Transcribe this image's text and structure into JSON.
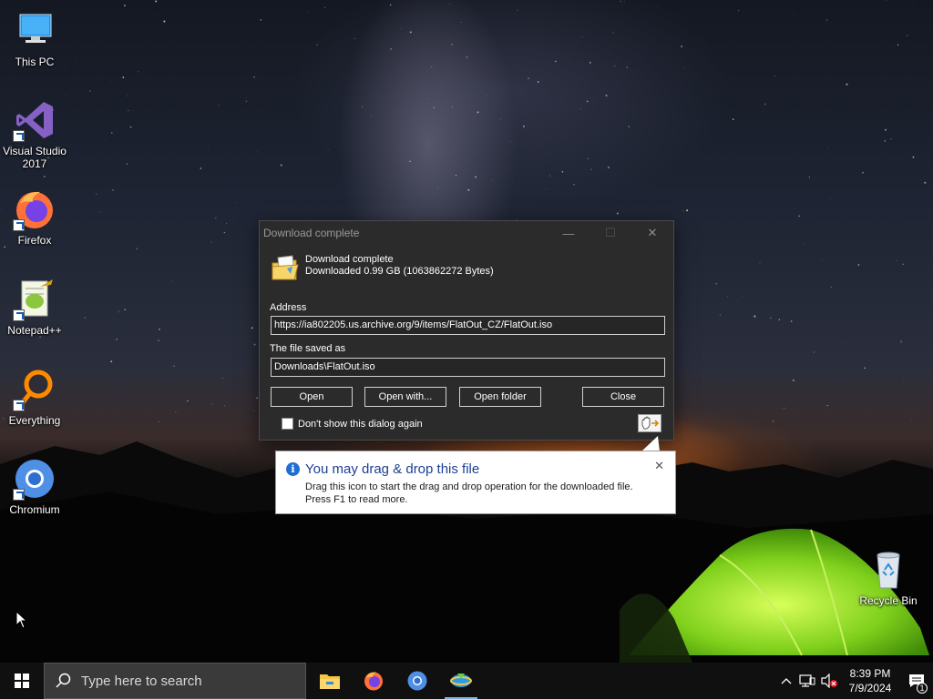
{
  "desktop": {
    "icons": [
      {
        "label": "This PC",
        "icon": "computer-icon"
      },
      {
        "label": "Visual Studio 2017",
        "icon": "visual-studio-icon"
      },
      {
        "label": "Firefox",
        "icon": "firefox-icon"
      },
      {
        "label": "Notepad++",
        "icon": "notepadpp-icon"
      },
      {
        "label": "Everything",
        "icon": "everything-search-icon"
      },
      {
        "label": "Chromium",
        "icon": "chromium-icon"
      },
      {
        "label": "Recycle Bin",
        "icon": "recycle-bin-icon"
      }
    ]
  },
  "dialog": {
    "title": "Download complete",
    "header_title": "Download complete",
    "header_detail": "Downloaded 0.99  GB (1063862272 Bytes)",
    "address_label": "Address",
    "address_value": "https://ia802205.us.archive.org/9/items/FlatOut_CZ/FlatOut.iso",
    "saved_label": "The file saved as",
    "saved_value": "Downloads\\FlatOut.iso",
    "buttons": {
      "open": "Open",
      "open_with": "Open with...",
      "open_folder": "Open folder",
      "close": "Close"
    },
    "checkbox_label": "Don't show this dialog again",
    "checkbox_checked": false
  },
  "tooltip": {
    "title": "You may drag & drop this file",
    "line1": "Drag this icon to start the drag and drop operation for the downloaded file.",
    "line2": "Press F1 to read more."
  },
  "taskbar": {
    "search_placeholder": "Type here to search",
    "apps": [
      "file-explorer-icon",
      "firefox-icon",
      "chromium-icon",
      "download-manager-icon"
    ],
    "time": "8:39 PM",
    "date": "7/9/2024",
    "notification_count": "1"
  },
  "colors": {
    "dialog_bg": "#2b2b2b",
    "tooltip_title": "#1c3f94",
    "info_blue": "#1f6fd1",
    "taskbar_bg": "#101010"
  }
}
